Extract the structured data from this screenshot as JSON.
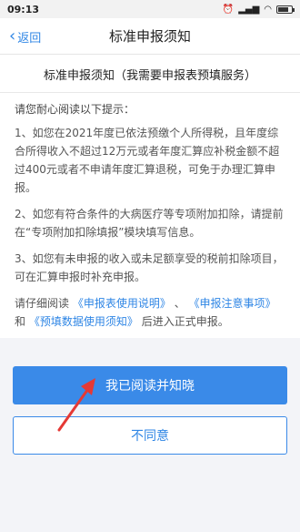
{
  "status_bar": {
    "time": "09:13",
    "battery_level": 0.8
  },
  "nav": {
    "back_label": "返回",
    "title": "标准申报须知"
  },
  "content": {
    "title": "标准申报须知（我需要申报表预填服务）",
    "intro": "请您耐心阅读以下提示：",
    "item1": "1、如您在2021年度已依法预缴个人所得税，且年度综合所得收入不超过12万元或者年度汇算应补税金额不超过400元或者不申请年度汇算退税，可免于办理汇算申报。",
    "item2": "2、如您有符合条件的大病医疗等专项附加扣除，请提前在“专项附加扣除填报”模块填写信息。",
    "item3": "3、如您有未申报的收入或未足额享受的税前扣除项目，可在汇算申报时补充申报。",
    "closing": {
      "prefix": "请仔细阅读",
      "link1": "《申报表使用说明》",
      "sep1": "、",
      "link2": "《申报注意事项》",
      "sep2": "和",
      "link3": "《预填数据使用须知》",
      "suffix": "后进入正式申报。"
    }
  },
  "buttons": {
    "agree": "我已阅读并知晓",
    "disagree": "不同意"
  },
  "colors": {
    "accent": "#3a8ae8",
    "arrow": "#e53935"
  }
}
